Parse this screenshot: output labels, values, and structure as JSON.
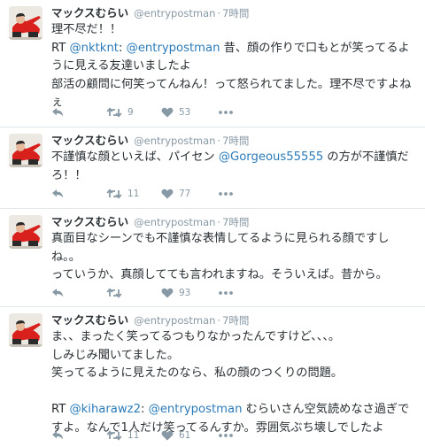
{
  "tweets": [
    {
      "name": "マックスむらい",
      "handle": "@entrypostman",
      "separator": "·",
      "time": "7時間",
      "lines": [
        [
          {
            "t": "理不尽だ！！"
          }
        ],
        [
          {
            "t": " RT "
          },
          {
            "t": "@nktknt",
            "m": true
          },
          {
            "t": ": "
          },
          {
            "t": "@entrypostman",
            "m": true
          },
          {
            "t": " 昔、顔の作りで口もとが笑ってるように見える友達いましたよ"
          }
        ],
        [
          {
            "t": "部活の顧問に何笑ってんねん！って怒られてました。理不尽ですよねぇ"
          }
        ]
      ],
      "retweets": "9",
      "likes": "53"
    },
    {
      "name": "マックスむらい",
      "handle": "@entrypostman",
      "separator": "·",
      "time": "7時間",
      "lines": [
        [
          {
            "t": "不謹慎な顔といえば、パイセン "
          },
          {
            "t": "@Gorgeous55555",
            "m": true
          },
          {
            "t": " の方が不謹慎だろ！！"
          }
        ]
      ],
      "retweets": "11",
      "likes": "77"
    },
    {
      "name": "マックスむらい",
      "handle": "@entrypostman",
      "separator": "·",
      "time": "7時間",
      "lines": [
        [
          {
            "t": "真面目なシーンでも不謹慎な表情してるように見られる顔ですしね。。"
          }
        ],
        [
          {
            "t": "っていうか、真顔してても言われますね。そういえば。昔から。"
          }
        ]
      ],
      "retweets": "",
      "likes": "93"
    },
    {
      "name": "マックスむらい",
      "handle": "@entrypostman",
      "separator": "·",
      "time": "7時間",
      "lines": [
        [
          {
            "t": "ま、、まったく笑ってるつもりなかったんですけど、、、。"
          }
        ],
        [
          {
            "t": "しみじみ聞いてました。"
          }
        ],
        [
          {
            "t": "笑ってるように見えたのなら、私の顔のつくりの問題。"
          }
        ],
        [],
        [
          {
            "t": " RT "
          },
          {
            "t": "@kiharawz2",
            "m": true
          },
          {
            "t": ": "
          },
          {
            "t": "@entrypostman",
            "m": true
          },
          {
            "t": " むらいさん空気読めなさ過ぎですよ。なんで1人だけ笑ってるんすか。雰囲気ぶち壊しでしたよ"
          }
        ]
      ],
      "retweets": "11",
      "likes": "61"
    }
  ],
  "icons": {
    "reply": "reply-icon",
    "retweet": "retweet-icon",
    "like": "heart-icon",
    "more": "more-dots-icon"
  },
  "colors": {
    "text": "#292f33",
    "meta": "#8899a6",
    "link": "#2b7bb9",
    "icon": "#8899a6",
    "divider": "#e1e8ed",
    "avatar_shirt": "#d8201c"
  }
}
